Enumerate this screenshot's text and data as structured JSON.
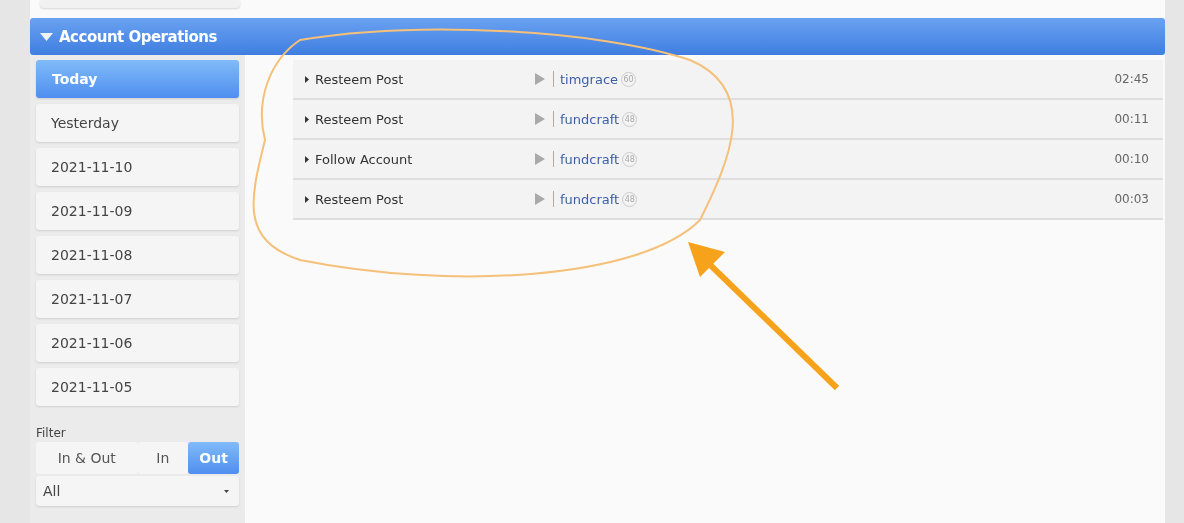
{
  "section": {
    "title": "Account Operations",
    "expanded": true
  },
  "days": [
    {
      "label": "Today",
      "selected": true
    },
    {
      "label": "Yesterday",
      "selected": false
    },
    {
      "label": "2021-11-10",
      "selected": false
    },
    {
      "label": "2021-11-09",
      "selected": false
    },
    {
      "label": "2021-11-08",
      "selected": false
    },
    {
      "label": "2021-11-07",
      "selected": false
    },
    {
      "label": "2021-11-06",
      "selected": false
    },
    {
      "label": "2021-11-05",
      "selected": false
    }
  ],
  "filter": {
    "label": "Filter",
    "options": [
      {
        "label": "In & Out",
        "selected": false
      },
      {
        "label": "In",
        "selected": false
      },
      {
        "label": "Out",
        "selected": true
      }
    ],
    "type_value": "All"
  },
  "operations": [
    {
      "type": "Resteem Post",
      "account": "timgrace",
      "reputation": "60",
      "time": "02:45"
    },
    {
      "type": "Resteem Post",
      "account": "fundcraft",
      "reputation": "48",
      "time": "00:11"
    },
    {
      "type": "Follow Account",
      "account": "fundcraft",
      "reputation": "48",
      "time": "00:10"
    },
    {
      "type": "Resteem Post",
      "account": "fundcraft",
      "reputation": "48",
      "time": "00:03"
    }
  ]
}
